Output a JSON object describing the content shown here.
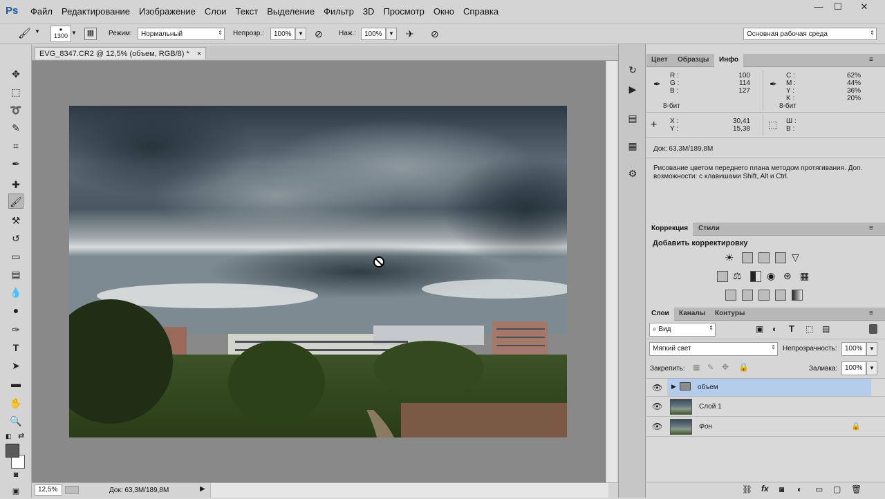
{
  "menubar": {
    "logo": "Ps",
    "items": [
      "Файл",
      "Редактирование",
      "Изображение",
      "Слои",
      "Текст",
      "Выделение",
      "Фильтр",
      "3D",
      "Просмотр",
      "Окно",
      "Справка"
    ],
    "window_buttons": {
      "minimize": "—",
      "maximize": "☐",
      "close": "✕"
    }
  },
  "options": {
    "brush_size": "1300",
    "mode_label": "Режим:",
    "mode_value": "Нормальный",
    "opacity_label": "Непрозр.:",
    "opacity_value": "100%",
    "flow_label": "Наж.:",
    "flow_value": "100%",
    "workspace": "Основная рабочая среда"
  },
  "document": {
    "tab_title": "EVG_8347.CR2 @ 12,5% (объем, RGB/8) *",
    "tab_close": "×",
    "zoom": "12,5%",
    "doc_info": "Док: 63,3M/189,8M"
  },
  "info_panel": {
    "tabs": [
      "Цвет",
      "Образцы",
      "Инфо"
    ],
    "active_tab": "Инфо",
    "rgb": {
      "r_label": "R :",
      "r": "100",
      "g_label": "G :",
      "g": "114",
      "b_label": "B :",
      "b": "127"
    },
    "cmyk": {
      "c_label": "C :",
      "c": "62%",
      "m_label": "M :",
      "m": "44%",
      "y_label": "Y :",
      "y": "36%",
      "k_label": "K :",
      "k": "20%"
    },
    "bit_left": "8-бит",
    "bit_right": "8-бит",
    "xy": {
      "x_label": "X :",
      "x": "30,41",
      "y_label": "Y :",
      "y": "15,38"
    },
    "wh": {
      "w_label": "Ш :",
      "h_label": "В :"
    },
    "doc": "Док: 63,3M/189,8M",
    "hint": "Рисование цветом переднего плана методом протягивания. Доп. возможности: с клавишами Shift, Alt и Ctrl."
  },
  "adjustments_panel": {
    "tabs": [
      "Коррекция",
      "Стили"
    ],
    "title": "Добавить корректировку"
  },
  "layers_panel": {
    "tabs": [
      "Слои",
      "Каналы",
      "Контуры"
    ],
    "filter": "Вид",
    "blend_mode": "Мягкий свет",
    "opacity_label": "Непрозрачность:",
    "opacity": "100%",
    "lock_label": "Закрепить:",
    "fill_label": "Заливка:",
    "fill": "100%",
    "layers": [
      {
        "name": "объем",
        "type": "group",
        "selected": true
      },
      {
        "name": "Слой 1",
        "type": "layer",
        "selected": false
      },
      {
        "name": "Фон",
        "type": "background",
        "selected": false
      }
    ]
  },
  "colors": {
    "accent": "#1b5aa6",
    "selected_layer": "#b4cdec"
  }
}
